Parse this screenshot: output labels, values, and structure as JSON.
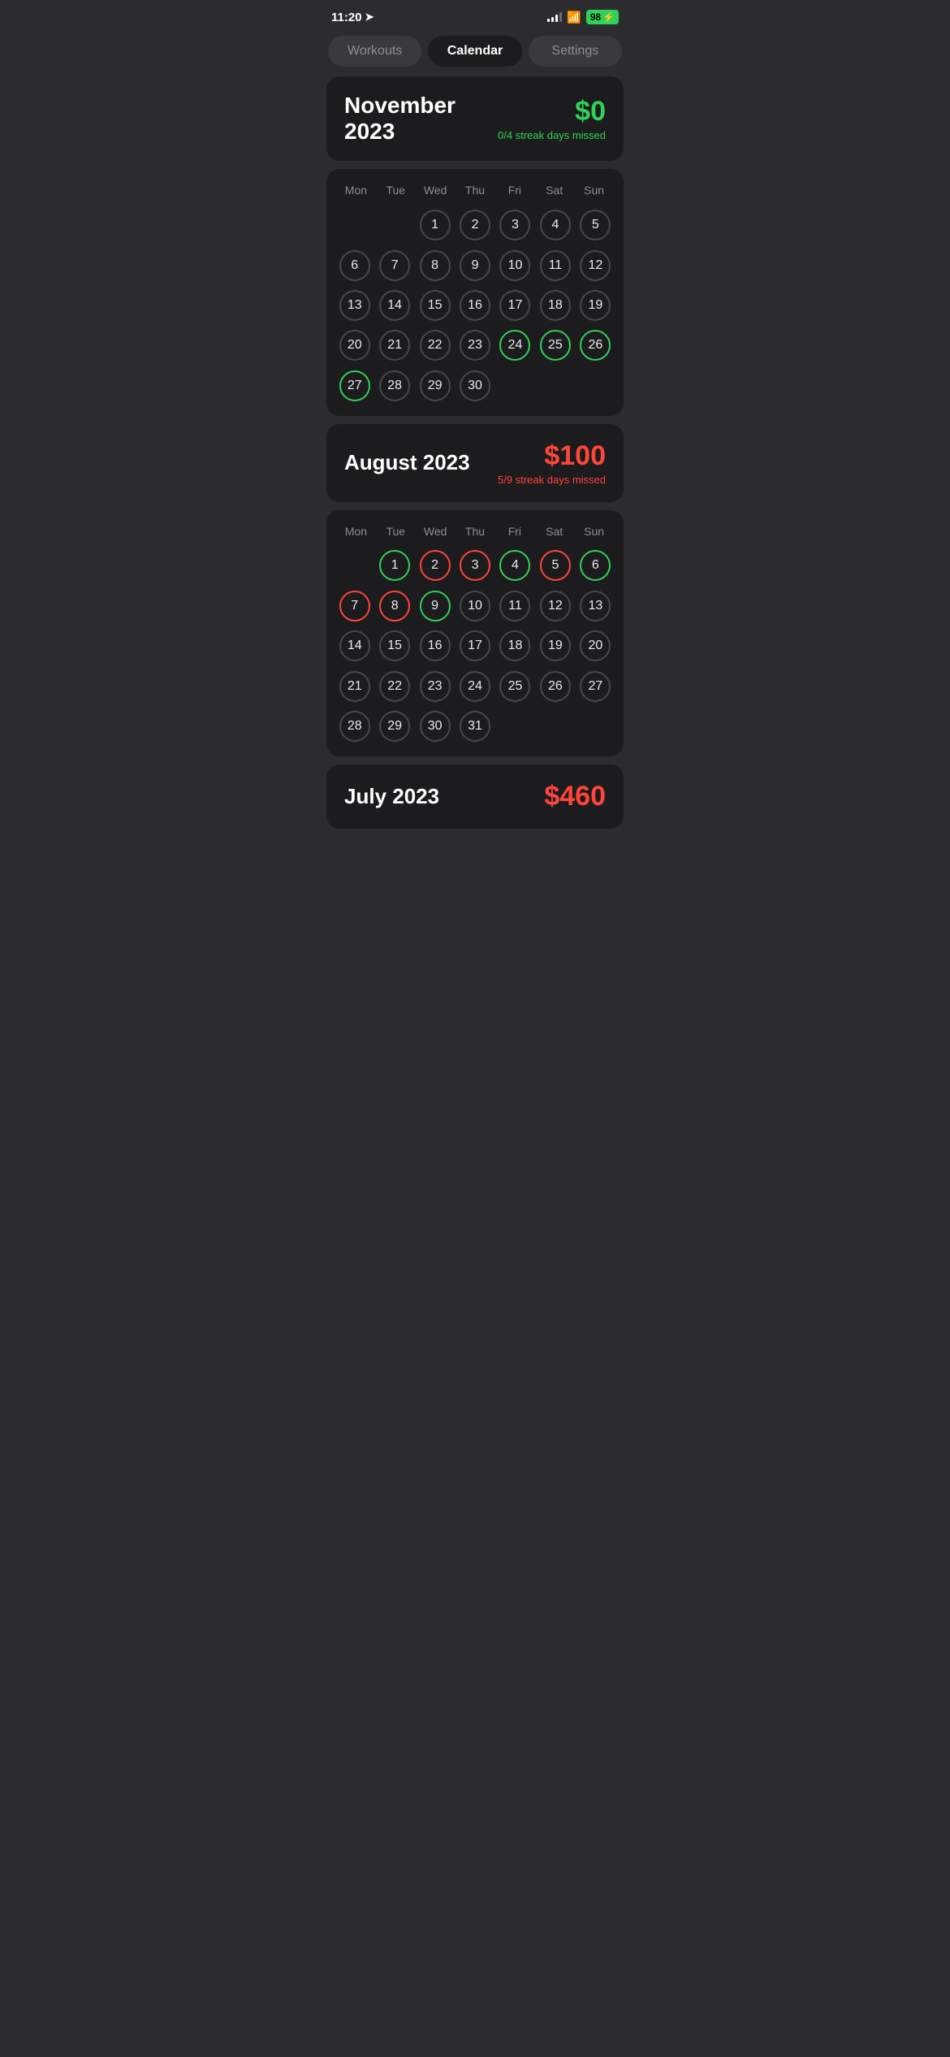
{
  "statusBar": {
    "time": "11:20",
    "battery": "98"
  },
  "tabs": [
    {
      "id": "workouts",
      "label": "Workouts",
      "active": false
    },
    {
      "id": "calendar",
      "label": "Calendar",
      "active": true
    },
    {
      "id": "settings",
      "label": "Settings",
      "active": false
    }
  ],
  "months": [
    {
      "id": "nov2023",
      "title": "November\n2023",
      "titleLine1": "November",
      "titleLine2": "2023",
      "amount": "$0",
      "amountColor": "green",
      "streakText": "0/4 streak days missed",
      "streakColor": "green",
      "dayHeaders": [
        "Mon",
        "Tue",
        "Wed",
        "Thu",
        "Fri",
        "Sat",
        "Sun"
      ],
      "weeks": [
        [
          null,
          null,
          {
            "n": 1,
            "style": "gray"
          },
          {
            "n": 2,
            "style": "gray"
          },
          {
            "n": 3,
            "style": "gray"
          },
          {
            "n": 4,
            "style": "gray"
          },
          {
            "n": 5,
            "style": "gray"
          }
        ],
        [
          {
            "n": 6,
            "style": "gray"
          },
          {
            "n": 7,
            "style": "gray"
          },
          {
            "n": 8,
            "style": "gray"
          },
          {
            "n": 9,
            "style": "gray"
          },
          {
            "n": 10,
            "style": "gray"
          },
          {
            "n": 11,
            "style": "gray"
          },
          {
            "n": 12,
            "style": "gray"
          }
        ],
        [
          {
            "n": 13,
            "style": "gray"
          },
          {
            "n": 14,
            "style": "gray"
          },
          {
            "n": 15,
            "style": "gray"
          },
          {
            "n": 16,
            "style": "gray"
          },
          {
            "n": 17,
            "style": "gray"
          },
          {
            "n": 18,
            "style": "gray"
          },
          {
            "n": 19,
            "style": "gray"
          }
        ],
        [
          {
            "n": 20,
            "style": "gray"
          },
          {
            "n": 21,
            "style": "gray"
          },
          {
            "n": 22,
            "style": "gray"
          },
          {
            "n": 23,
            "style": "gray"
          },
          {
            "n": 24,
            "style": "green"
          },
          {
            "n": 25,
            "style": "green"
          },
          {
            "n": 26,
            "style": "green"
          }
        ],
        [
          {
            "n": 27,
            "style": "green"
          },
          {
            "n": 28,
            "style": "gray"
          },
          {
            "n": 29,
            "style": "gray"
          },
          {
            "n": 30,
            "style": "gray"
          },
          null,
          null,
          null
        ]
      ]
    },
    {
      "id": "aug2023",
      "title": "August 2023",
      "titleLine1": "August 2023",
      "titleLine2": "",
      "amount": "$100",
      "amountColor": "red",
      "streakText": "5/9 streak days missed",
      "streakColor": "red",
      "dayHeaders": [
        "Mon",
        "Tue",
        "Wed",
        "Thu",
        "Fri",
        "Sat",
        "Sun"
      ],
      "weeks": [
        [
          null,
          {
            "n": 1,
            "style": "green"
          },
          {
            "n": 2,
            "style": "red"
          },
          {
            "n": 3,
            "style": "red"
          },
          {
            "n": 4,
            "style": "green"
          },
          {
            "n": 5,
            "style": "red"
          },
          {
            "n": 6,
            "style": "green"
          }
        ],
        [
          {
            "n": 7,
            "style": "red"
          },
          {
            "n": 8,
            "style": "red"
          },
          {
            "n": 9,
            "style": "green"
          },
          {
            "n": 10,
            "style": "gray"
          },
          {
            "n": 11,
            "style": "gray"
          },
          {
            "n": 12,
            "style": "gray"
          },
          {
            "n": 13,
            "style": "gray"
          }
        ],
        [
          {
            "n": 14,
            "style": "gray"
          },
          {
            "n": 15,
            "style": "gray"
          },
          {
            "n": 16,
            "style": "gray"
          },
          {
            "n": 17,
            "style": "gray"
          },
          {
            "n": 18,
            "style": "gray"
          },
          {
            "n": 19,
            "style": "gray"
          },
          {
            "n": 20,
            "style": "gray"
          }
        ],
        [
          {
            "n": 21,
            "style": "gray"
          },
          {
            "n": 22,
            "style": "gray"
          },
          {
            "n": 23,
            "style": "gray"
          },
          {
            "n": 24,
            "style": "gray"
          },
          {
            "n": 25,
            "style": "gray"
          },
          {
            "n": 26,
            "style": "gray"
          },
          {
            "n": 27,
            "style": "gray"
          }
        ],
        [
          {
            "n": 28,
            "style": "gray"
          },
          {
            "n": 29,
            "style": "gray"
          },
          {
            "n": 30,
            "style": "gray"
          },
          {
            "n": 31,
            "style": "gray"
          },
          null,
          null,
          null
        ]
      ]
    },
    {
      "id": "jul2023",
      "titleLine1": "July 2023",
      "amount": "$460",
      "amountColor": "red",
      "partial": true
    }
  ]
}
